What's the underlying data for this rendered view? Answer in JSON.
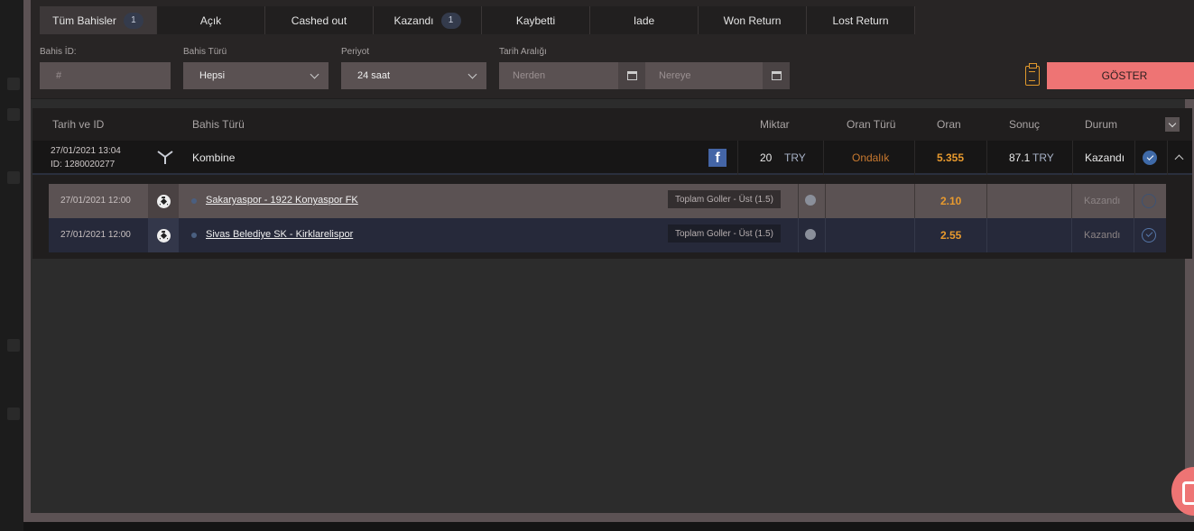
{
  "tabs": [
    {
      "label": "Tüm Bahisler",
      "badge": "1"
    },
    {
      "label": "Açık"
    },
    {
      "label": "Cashed out"
    },
    {
      "label": "Kazandı",
      "badge": "1"
    },
    {
      "label": "Kaybetti"
    },
    {
      "label": "Iade"
    },
    {
      "label": "Won Return"
    },
    {
      "label": "Lost Return"
    }
  ],
  "filters": {
    "bet_id_label": "Bahis İD:",
    "bet_id_placeholder": "#",
    "bet_type_label": "Bahis Türü",
    "bet_type_value": "Hepsi",
    "period_label": "Periyot",
    "period_value": "24 saat",
    "date_range_label": "Tarih Aralığı",
    "from_placeholder": "Nerden",
    "to_placeholder": "Nereye",
    "show_button": "GÖSTER"
  },
  "table": {
    "headers": {
      "date_id": "Tarih ve ID",
      "bet_type": "Bahis Türü",
      "amount": "Miktar",
      "odds_type": "Oran Türü",
      "odds": "Oran",
      "result": "Sonuç",
      "status": "Durum"
    },
    "bet": {
      "date": "27/01/2021 13:04",
      "id": "ID: 1280020277",
      "type": "Kombine",
      "amount": "20",
      "currency": "TRY",
      "odds_type": "Ondalık",
      "odds": "5.355",
      "result": "87.1",
      "result_currency": "TRY",
      "status": "Kazandı",
      "facebook": "f"
    },
    "selections": [
      {
        "date": "27/01/2021 12:00",
        "match": "Sakaryaspor - 1922 Konyaspor FK",
        "market": "Toplam Goller - Üst (1.5)",
        "odds": "2.10",
        "status": "Kazandı"
      },
      {
        "date": "27/01/2021 12:00",
        "match": "Sivas Belediye SK - Kirklarelispor",
        "market": "Toplam Goller - Üst (1.5)",
        "odds": "2.55",
        "status": "Kazandı"
      }
    ]
  },
  "colors": {
    "accent": "#ee7474",
    "odds": "#e89a2e",
    "modal_frame": "#5c5254"
  }
}
